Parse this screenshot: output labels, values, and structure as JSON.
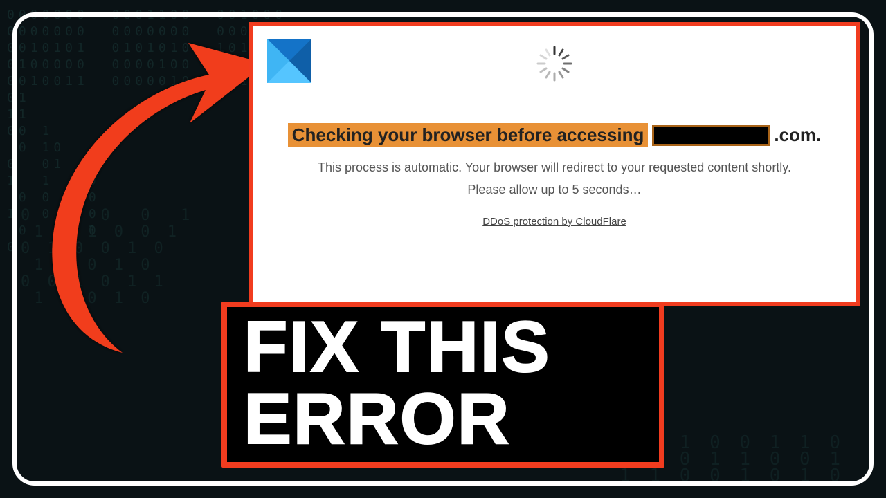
{
  "banner": {
    "text": "FIX THIS ERROR"
  },
  "panel": {
    "headline_prefix": "Checking your browser before accessing",
    "headline_suffix": ".com.",
    "line1": "This process is automatic. Your browser will redirect to your requested content shortly.",
    "line2": "Please allow up to 5 seconds…",
    "ddos": "DDoS protection by CloudFlare"
  },
  "colors": {
    "accent": "#f13c1f",
    "highlight": "#e89136"
  }
}
